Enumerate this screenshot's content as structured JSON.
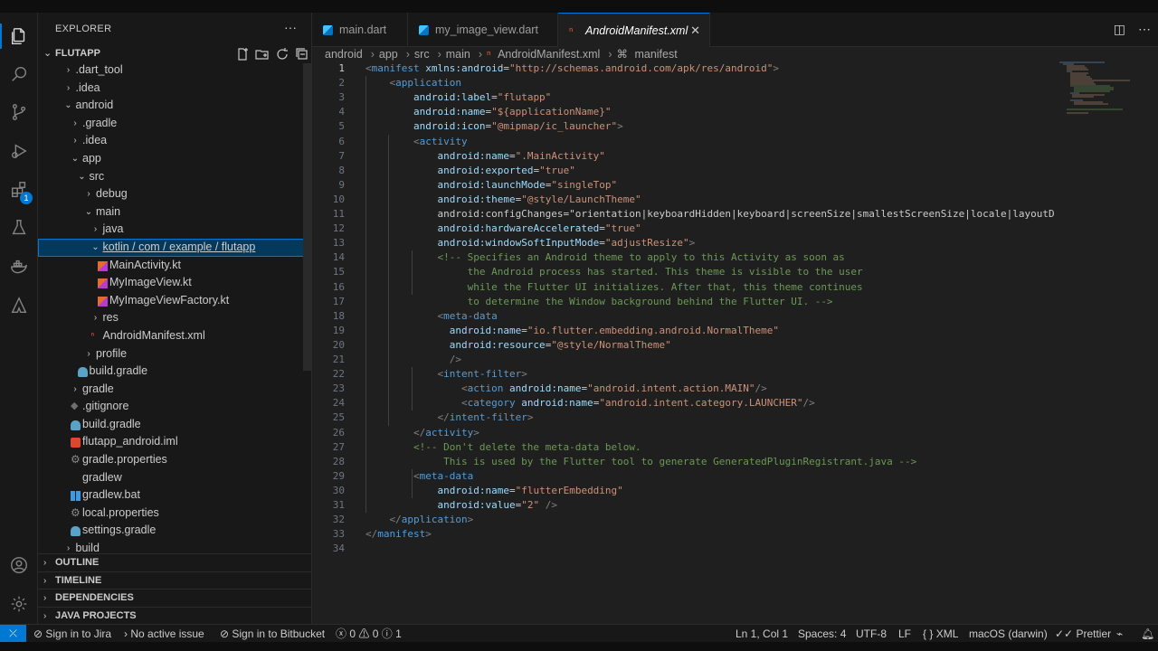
{
  "sidebar": {
    "title": "EXPLORER",
    "more": "···",
    "project": "FLUTAPP",
    "tree": [
      {
        "label": ".dart_tool",
        "depth": 1,
        "tw": "›"
      },
      {
        "label": ".idea",
        "depth": 1,
        "tw": "›"
      },
      {
        "label": "android",
        "depth": 1,
        "tw": "⌄"
      },
      {
        "label": ".gradle",
        "depth": 2,
        "tw": "›"
      },
      {
        "label": ".idea",
        "depth": 2,
        "tw": "›"
      },
      {
        "label": "app",
        "depth": 2,
        "tw": "⌄"
      },
      {
        "label": "src",
        "depth": 3,
        "tw": "⌄"
      },
      {
        "label": "debug",
        "depth": 4,
        "tw": "›"
      },
      {
        "label": "main",
        "depth": 4,
        "tw": "⌄"
      },
      {
        "label": "java",
        "depth": 5,
        "tw": "›"
      },
      {
        "label": "kotlin / com / example / flutapp",
        "depth": 5,
        "tw": "⌄",
        "selected": true
      },
      {
        "label": "MainActivity.kt",
        "depth": 6,
        "icon": "kotlin"
      },
      {
        "label": "MyImageView.kt",
        "depth": 6,
        "icon": "kotlin"
      },
      {
        "label": "MyImageViewFactory.kt",
        "depth": 6,
        "icon": "kotlin"
      },
      {
        "label": "res",
        "depth": 5,
        "tw": "›"
      },
      {
        "label": "AndroidManifest.xml",
        "depth": 5,
        "icon": "xml"
      },
      {
        "label": "profile",
        "depth": 4,
        "tw": "›"
      },
      {
        "label": "build.gradle",
        "depth": 3,
        "icon": "gradle"
      },
      {
        "label": "gradle",
        "depth": 2,
        "tw": "›"
      },
      {
        "label": ".gitignore",
        "depth": 2,
        "icon": "git"
      },
      {
        "label": "build.gradle",
        "depth": 2,
        "icon": "gradle"
      },
      {
        "label": "flutapp_android.iml",
        "depth": 2,
        "icon": "iml"
      },
      {
        "label": "gradle.properties",
        "depth": 2,
        "icon": "gear"
      },
      {
        "label": "gradlew",
        "depth": 2,
        "icon": "none"
      },
      {
        "label": "gradlew.bat",
        "depth": 2,
        "icon": "windows"
      },
      {
        "label": "local.properties",
        "depth": 2,
        "icon": "gear"
      },
      {
        "label": "settings.gradle",
        "depth": 2,
        "icon": "gradle"
      },
      {
        "label": "build",
        "depth": 1,
        "tw": "›"
      }
    ],
    "sections": [
      "OUTLINE",
      "TIMELINE",
      "DEPENDENCIES",
      "JAVA PROJECTS"
    ]
  },
  "activity": {
    "badge": "1"
  },
  "tabs": [
    {
      "label": "main.dart",
      "icon": "dart"
    },
    {
      "label": "my_image_view.dart",
      "icon": "dart"
    },
    {
      "label": "AndroidManifest.xml",
      "icon": "xml",
      "active": true,
      "close": "✕"
    }
  ],
  "breadcrumb": [
    "android",
    "app",
    "src",
    "main",
    "AndroidManifest.xml",
    "manifest"
  ],
  "code": [
    "<manifest xmlns:android=\"http://schemas.android.com/apk/res/android\">",
    "    <application",
    "        android:label=\"flutapp\"",
    "        android:name=\"${applicationName}\"",
    "        android:icon=\"@mipmap/ic_launcher\">",
    "        <activity",
    "            android:name=\".MainActivity\"",
    "            android:exported=\"true\"",
    "            android:launchMode=\"singleTop\"",
    "            android:theme=\"@style/LaunchTheme\"",
    "            android:configChanges=\"orientation|keyboardHidden|keyboard|screenSize|smallestScreenSize|locale|layoutDire",
    "            android:hardwareAccelerated=\"true\"",
    "            android:windowSoftInputMode=\"adjustResize\">",
    "            <!-- Specifies an Android theme to apply to this Activity as soon as",
    "                 the Android process has started. This theme is visible to the user",
    "                 while the Flutter UI initializes. After that, this theme continues",
    "                 to determine the Window background behind the Flutter UI. -->",
    "            <meta-data",
    "              android:name=\"io.flutter.embedding.android.NormalTheme\"",
    "              android:resource=\"@style/NormalTheme\"",
    "              />",
    "            <intent-filter>",
    "                <action android:name=\"android.intent.action.MAIN\"/>",
    "                <category android:name=\"android.intent.category.LAUNCHER\"/>",
    "            </intent-filter>",
    "        </activity>",
    "        <!-- Don't delete the meta-data below.",
    "             This is used by the Flutter tool to generate GeneratedPluginRegistrant.java -->",
    "        <meta-data",
    "            android:name=\"flutterEmbedding\"",
    "            android:value=\"2\" />",
    "    </application>",
    "</manifest>",
    ""
  ],
  "status": {
    "jira": "Sign in to Jira",
    "issue": "No active issue",
    "bitbucket": "Sign in to Bitbucket",
    "errors": "0",
    "warnings": "0",
    "info": "1",
    "position": "Ln 1, Col 1",
    "spaces": "Spaces: 4",
    "encoding": "UTF-8",
    "eol": "LF",
    "language": "XML",
    "platform": "macOS (darwin)",
    "formatter": "Prettier"
  }
}
